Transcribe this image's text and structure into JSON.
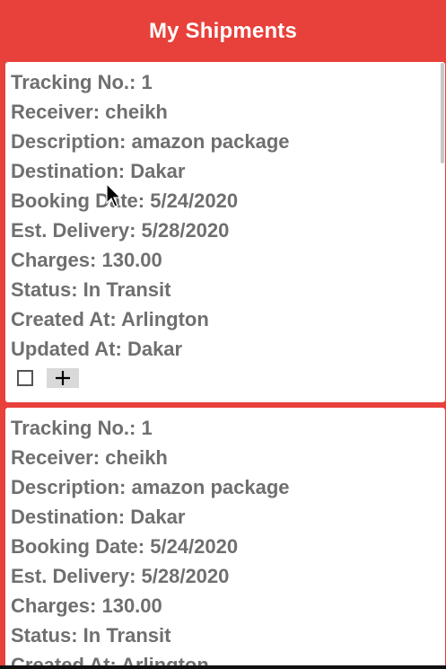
{
  "header": {
    "title": "My Shipments"
  },
  "shipments": [
    {
      "tracking": "Tracking No.: 1",
      "receiver": "Receiver: cheikh",
      "description": "Description: amazon package",
      "destination": "Destination: Dakar",
      "booking_date": "Booking Date: 5/24/2020",
      "est_delivery": "Est. Delivery: 5/28/2020",
      "charges": "Charges: 130.00",
      "status": "Status: In Transit",
      "created_at": "Created At: Arlington",
      "updated_at": "Updated At: Dakar"
    },
    {
      "tracking": "Tracking No.: 1",
      "receiver": "Receiver: cheikh",
      "description": "Description: amazon package",
      "destination": "Destination: Dakar",
      "booking_date": "Booking Date: 5/24/2020",
      "est_delivery": "Est. Delivery: 5/28/2020",
      "charges": "Charges: 130.00",
      "status": "Status: In Transit",
      "created_at": "Created At: Arlington"
    }
  ],
  "actions": {
    "checkbox_checked": false,
    "add_icon": "plus-icon"
  },
  "colors": {
    "header_background": "#e8403a",
    "card_background": "#ffffff",
    "field_text": "#6f6f6f"
  }
}
